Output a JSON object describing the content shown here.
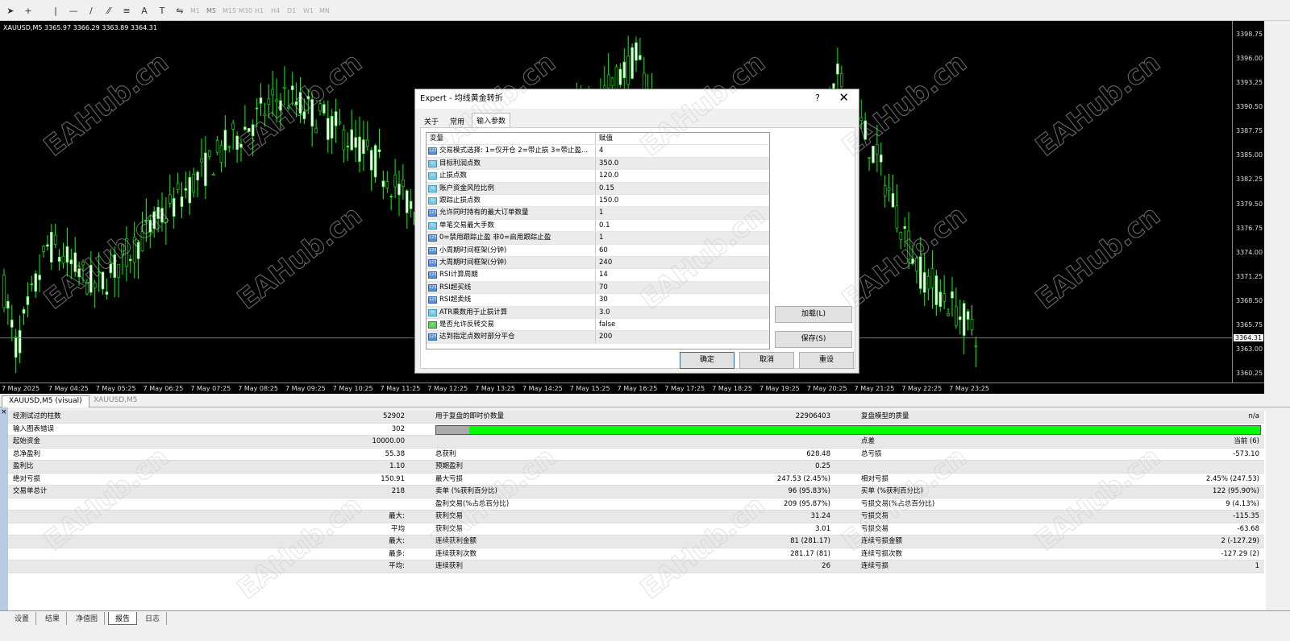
{
  "toolbar": {
    "tools": [
      {
        "icon": "cursor-icon",
        "g": "➤"
      },
      {
        "icon": "crosshair-icon",
        "g": "+"
      },
      {
        "icon": "vertical-line-icon",
        "g": "|"
      },
      {
        "icon": "horizontal-line-icon",
        "g": "—"
      },
      {
        "icon": "trendline-icon",
        "g": "/"
      },
      {
        "icon": "fibonacci-icon",
        "g": "⁄⁄"
      },
      {
        "icon": "fibo-levels-icon",
        "g": "≡"
      },
      {
        "icon": "text-icon",
        "g": "A"
      },
      {
        "icon": "text-label-icon",
        "g": "T"
      },
      {
        "icon": "arrows-icon",
        "g": "⇋"
      }
    ],
    "timeframes": [
      "M1",
      "M5",
      "M15",
      "M30",
      "H1",
      "H4",
      "D1",
      "W1",
      "MN"
    ]
  },
  "chart": {
    "label": "XAUUSD,M5  3365.97 3366.29 3363.89 3364.31",
    "current_price": "3364.31",
    "price_labels": [
      "3398.75",
      "3396.00",
      "3393.25",
      "3390.50",
      "3387.75",
      "3385.00",
      "3382.25",
      "3379.50",
      "3376.75",
      "3374.00",
      "3371.25",
      "3368.50",
      "3365.75",
      "3363.00",
      "3360.25"
    ],
    "time_labels": [
      "7 May 2025",
      "7 May 04:25",
      "7 May 05:25",
      "7 May 06:25",
      "7 May 07:25",
      "7 May 08:25",
      "7 May 09:25",
      "7 May 10:25",
      "7 May 11:25",
      "7 May 12:25",
      "7 May 13:25",
      "7 May 14:25",
      "7 May 15:25",
      "7 May 16:25",
      "7 May 17:25",
      "7 May 18:25",
      "7 May 19:25",
      "7 May 20:25",
      "7 May 21:25",
      "7 May 22:25",
      "7 May 23:25"
    ],
    "bull_color": "#00ff00",
    "bear_color": "#ffffff"
  },
  "chart_tabs": [
    "XAUUSD,M5 (visual)",
    "XAUUSD,M5"
  ],
  "report": {
    "rows": [
      [
        "经测试过的柱数",
        "52902",
        "用于复盘的即时价数量",
        "22906403",
        "复盘模型的质量",
        "n/a"
      ],
      [
        "输入图表错误",
        "302",
        "",
        "",
        "",
        ""
      ],
      [
        "起始资金",
        "10000.00",
        "",
        "",
        "点差",
        "当前 (6)"
      ],
      [
        "总净盈利",
        "55.38",
        "总获利",
        "628.48",
        "总亏损",
        "-573.10"
      ],
      [
        "盈利比",
        "1.10",
        "预期盈利",
        "0.25",
        "",
        ""
      ],
      [
        "绝对亏损",
        "150.91",
        "最大亏损",
        "247.53 (2.45%)",
        "相对亏损",
        "2.45% (247.53)"
      ],
      [
        "交易单总计",
        "218",
        "卖单 (%获利百分比)",
        "96 (95.83%)",
        "买单 (%获利百分比)",
        "122 (95.90%)"
      ],
      [
        "",
        "",
        "盈利交易(%占总百分比)",
        "209 (95.87%)",
        "亏损交易(%占总百分比)",
        "9 (4.13%)"
      ],
      [
        "",
        "最大:",
        "获利交易",
        "31.24",
        "亏损交易",
        "-115.35"
      ],
      [
        "",
        "平均",
        "获利交易",
        "3.01",
        "亏损交易",
        "-63.68"
      ],
      [
        "",
        "最大:",
        "连续获利金额",
        "81 (281.17)",
        "连续亏损金额",
        "2 (-127.29)"
      ],
      [
        "",
        "最多:",
        "连续获利次数",
        "281.17 (81)",
        "连续亏损次数",
        "-127.29 (2)"
      ],
      [
        "",
        "平均:",
        "连续获利",
        "26",
        "连续亏损",
        "1"
      ]
    ],
    "quality_bar_gray_fraction": 0.04,
    "quality_bar_color": "#00ff00"
  },
  "bottom_tabs": [
    "设置",
    "结果",
    "净值图",
    "报告",
    "日志"
  ],
  "dialog": {
    "title": "Expert - 均线黄金转折",
    "help": "?",
    "close": "✕",
    "tabs": [
      "关于",
      "常用",
      "输入参数"
    ],
    "header": {
      "variable": "变量",
      "value": "赋值"
    },
    "params": [
      {
        "type": "int",
        "name": "交易模式选择: 1=仅开仓 2=带止损 3=带止盈...",
        "value": "4"
      },
      {
        "type": "double",
        "name": "目标利润点数",
        "value": "350.0"
      },
      {
        "type": "double",
        "name": "止损点数",
        "value": "120.0"
      },
      {
        "type": "double",
        "name": "账户资金风险比例",
        "value": "0.15"
      },
      {
        "type": "double",
        "name": "跟踪止损点数",
        "value": "150.0"
      },
      {
        "type": "int",
        "name": "允许同时持有的最大订单数量",
        "value": "1"
      },
      {
        "type": "double",
        "name": "单笔交易最大手数",
        "value": "0.1"
      },
      {
        "type": "int",
        "name": "0=禁用跟踪止盈 非0=启用跟踪止盈",
        "value": "1"
      },
      {
        "type": "int",
        "name": "小周期时间框架(分钟)",
        "value": "60"
      },
      {
        "type": "int",
        "name": "大周期时间框架(分钟)",
        "value": "240"
      },
      {
        "type": "int",
        "name": "RSI计算周期",
        "value": "14"
      },
      {
        "type": "int",
        "name": "RSI超买线",
        "value": "70"
      },
      {
        "type": "int",
        "name": "RSI超卖线",
        "value": "30"
      },
      {
        "type": "double",
        "name": "ATR乘数用于止损计算",
        "value": "3.0"
      },
      {
        "type": "bool",
        "name": "是否允许反转交易",
        "value": "false"
      },
      {
        "type": "int",
        "name": "达到指定点数时部分平仓",
        "value": "200"
      }
    ],
    "buttons": {
      "load": "加载(L)",
      "save": "保存(S)",
      "ok": "确定",
      "cancel": "取消",
      "reset": "重设"
    }
  },
  "watermark": "EAHub.cn"
}
